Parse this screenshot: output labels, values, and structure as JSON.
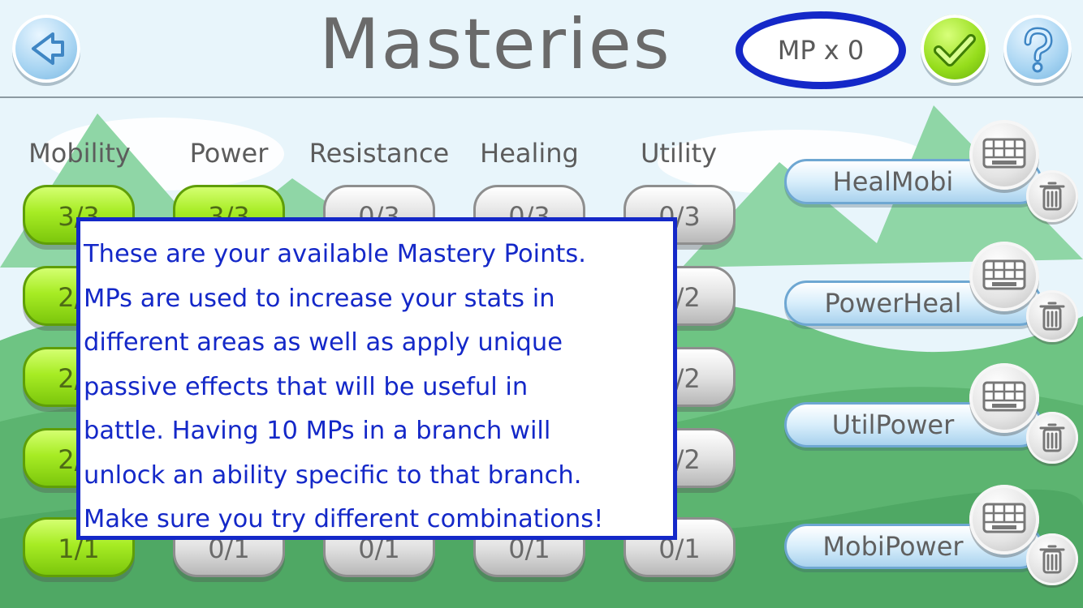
{
  "header": {
    "title": "Masteries",
    "mp_counter": "MP x 0"
  },
  "buttons": {
    "back_icon": "back-arrow-icon",
    "confirm_icon": "checkmark-icon",
    "help_icon": "question-mark-icon"
  },
  "columns": [
    {
      "label": "Mobility"
    },
    {
      "label": "Power"
    },
    {
      "label": "Resistance"
    },
    {
      "label": "Healing"
    },
    {
      "label": "Utility"
    }
  ],
  "grid": {
    "rows": [
      [
        {
          "value": "3/3",
          "state": "unlocked"
        },
        {
          "value": "3/3",
          "state": "unlocked"
        },
        {
          "value": "0/3",
          "state": "locked"
        },
        {
          "value": "0/3",
          "state": "locked"
        },
        {
          "value": "0/3",
          "state": "locked"
        }
      ],
      [
        {
          "value": "2/2",
          "state": "unlocked"
        },
        {
          "value": "",
          "state": "hidden"
        },
        {
          "value": "",
          "state": "hidden"
        },
        {
          "value": "",
          "state": "hidden"
        },
        {
          "value": "0/2",
          "state": "locked"
        }
      ],
      [
        {
          "value": "2/2",
          "state": "unlocked"
        },
        {
          "value": "",
          "state": "hidden"
        },
        {
          "value": "",
          "state": "hidden"
        },
        {
          "value": "",
          "state": "hidden"
        },
        {
          "value": "0/2",
          "state": "locked"
        }
      ],
      [
        {
          "value": "2/2",
          "state": "unlocked"
        },
        {
          "value": "",
          "state": "hidden"
        },
        {
          "value": "",
          "state": "hidden"
        },
        {
          "value": "",
          "state": "hidden"
        },
        {
          "value": "0/2",
          "state": "locked"
        }
      ],
      [
        {
          "value": "1/1",
          "state": "unlocked"
        },
        {
          "value": "0/1",
          "state": "locked"
        },
        {
          "value": "0/1",
          "state": "locked"
        },
        {
          "value": "0/1",
          "state": "locked"
        },
        {
          "value": "0/1",
          "state": "locked"
        }
      ]
    ]
  },
  "presets": [
    {
      "name": "HealMobi"
    },
    {
      "name": "PowerHeal"
    },
    {
      "name": "UtilPower"
    },
    {
      "name": "MobiPower"
    }
  ],
  "tutorial": {
    "lines": [
      "These are your available Mastery Points.",
      "MPs are used to increase your stats in",
      "different areas as well as apply unique",
      "passive effects that will be useful in",
      "battle. Having 10 MPs in a branch will",
      "unlock an ability specific to that branch.",
      "Make sure you try different combinations!"
    ]
  },
  "colors": {
    "highlight": "#1428c8",
    "unlocked": "#a7ec24",
    "locked": "#d8d8d8",
    "title": "#6a6a6a"
  }
}
